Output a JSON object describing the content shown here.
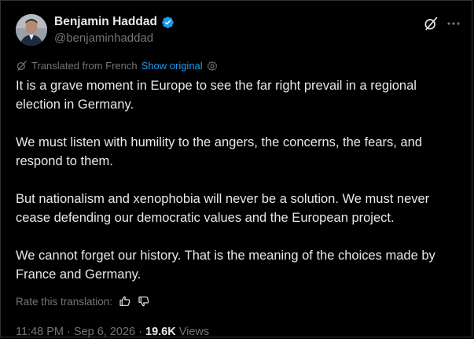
{
  "author": {
    "name": "Benjamin Haddad",
    "handle": "@benjaminhaddad"
  },
  "translation": {
    "label": "Translated from French",
    "show_original": "Show original"
  },
  "paragraphs": [
    "It is a grave moment in Europe to see the far right prevail in a regional election in Germany.",
    "We must listen with humility to the angers, the concerns, the fears, and respond to them.",
    "But nationalism and xenophobia will never be a solution. We must never cease defending our democratic values and the European project.",
    "We cannot forget our history. That is the meaning of the choices made by France and Germany."
  ],
  "rate": {
    "label": "Rate this translation:"
  },
  "meta": {
    "time": "11:48 PM",
    "date": "Sep 6, 2026",
    "views_count": "19.6K",
    "views_label": "Views"
  },
  "colors": {
    "background": "#000000",
    "text": "#e7e9ea",
    "muted": "#71767b",
    "link": "#1d9bf0",
    "verified": "#1d9bf0"
  },
  "icons": [
    "verified-badge-icon",
    "grok-icon",
    "more-icon",
    "translate-icon",
    "settings-icon",
    "thumbs-up-icon",
    "thumbs-down-icon"
  ]
}
